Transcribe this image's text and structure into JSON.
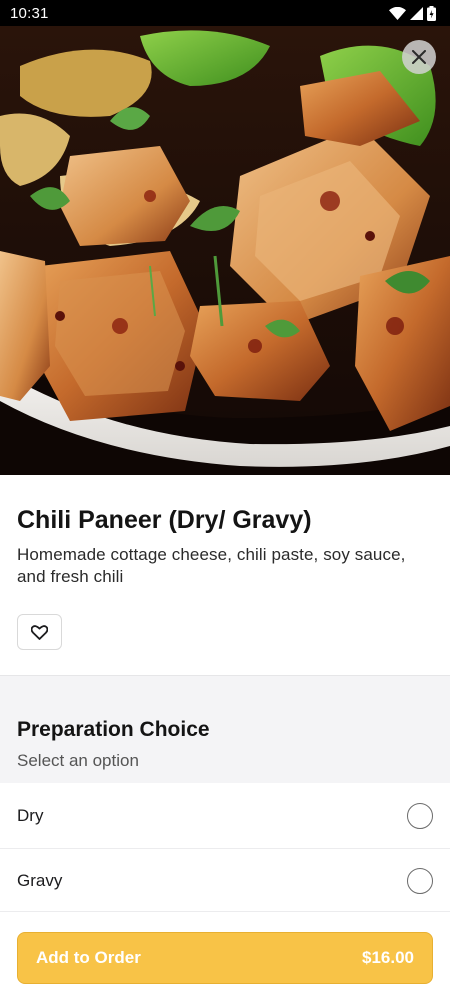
{
  "status_bar": {
    "time": "10:31",
    "icons": [
      "wifi-icon",
      "signal-icon",
      "battery-icon"
    ]
  },
  "hero": {
    "close_icon": "close-icon"
  },
  "item": {
    "title": "Chili Paneer (Dry/ Gravy)",
    "description": "Homemade cottage cheese, chili paste, soy sauce, and fresh chili",
    "favorite_icon": "heart-icon"
  },
  "preparation": {
    "title": "Preparation Choice",
    "subtitle": "Select an option",
    "options": [
      {
        "label": "Dry",
        "selected": false
      },
      {
        "label": "Gravy",
        "selected": false
      }
    ]
  },
  "footer": {
    "add_label": "Add to Order",
    "price": "$16.00"
  },
  "colors": {
    "accent": "#f8c347",
    "status_bar": "#000000",
    "section_bg": "#f4f4f6"
  }
}
